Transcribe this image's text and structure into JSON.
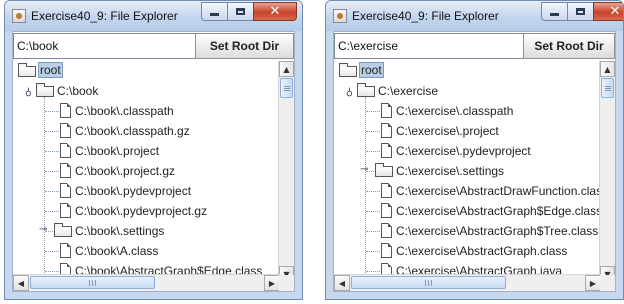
{
  "windows": [
    {
      "title": "Exercise40_9: File Explorer",
      "path_value": "C:\\book",
      "set_root_label": "Set Root Dir",
      "tree": {
        "root_label": "root",
        "expanded_label": "C:\\book",
        "items": [
          {
            "label": "C:\\book\\.classpath",
            "type": "file"
          },
          {
            "label": "C:\\book\\.classpath.gz",
            "type": "file"
          },
          {
            "label": "C:\\book\\.project",
            "type": "file"
          },
          {
            "label": "C:\\book\\.project.gz",
            "type": "file"
          },
          {
            "label": "C:\\book\\.pydevproject",
            "type": "file"
          },
          {
            "label": "C:\\book\\.pydevproject.gz",
            "type": "file"
          },
          {
            "label": "C:\\book\\.settings",
            "type": "folder"
          },
          {
            "label": "C:\\book\\A.class",
            "type": "file"
          },
          {
            "label": "C:\\book\\AbstractGraph$Edge.class",
            "type": "file"
          }
        ]
      },
      "icons": {
        "app": "java-cup-icon",
        "minimize": "minimize-icon",
        "maximize": "maximize-icon",
        "close": "close-icon",
        "folder": "folder-icon",
        "file": "file-icon"
      }
    },
    {
      "title": "Exercise40_9: File Explorer",
      "path_value": "C:\\exercise",
      "set_root_label": "Set Root Dir",
      "tree": {
        "root_label": "root",
        "expanded_label": "C:\\exercise",
        "items": [
          {
            "label": "C:\\exercise\\.classpath",
            "type": "file"
          },
          {
            "label": "C:\\exercise\\.project",
            "type": "file"
          },
          {
            "label": "C:\\exercise\\.pydevproject",
            "type": "file"
          },
          {
            "label": "C:\\exercise\\.settings",
            "type": "folder"
          },
          {
            "label": "C:\\exercise\\AbstractDrawFunction.class",
            "type": "file"
          },
          {
            "label": "C:\\exercise\\AbstractGraph$Edge.class",
            "type": "file"
          },
          {
            "label": "C:\\exercise\\AbstractGraph$Tree.class",
            "type": "file"
          },
          {
            "label": "C:\\exercise\\AbstractGraph.class",
            "type": "file"
          },
          {
            "label": "C:\\exercise\\AbstractGraph.java",
            "type": "file"
          }
        ]
      },
      "icons": {
        "app": "java-cup-icon",
        "minimize": "minimize-icon",
        "maximize": "maximize-icon",
        "close": "close-icon",
        "folder": "folder-icon",
        "file": "file-icon"
      }
    }
  ],
  "colors": {
    "title_bar": "#c2d5ee",
    "close_button": "#c7432b",
    "selection": "#b8cfe5",
    "tree_lines": "#8a9bb0"
  }
}
